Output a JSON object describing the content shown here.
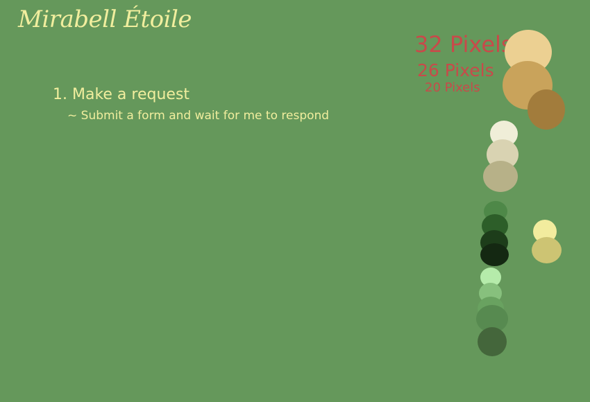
{
  "brand": {
    "name": "Mirabell Étoile"
  },
  "steps": [
    {
      "title": "1. Make a request",
      "description": "~ Submit a form and wait for me to respond"
    }
  ],
  "size_samples": {
    "large": "32 Pixels",
    "medium": "26 Pixels",
    "small": "20 Pixels"
  },
  "colors": {
    "background": "#65985b",
    "text": "#f1ee9e",
    "size_label": "#c84a4a",
    "swatches": {
      "tan": [
        "#ecd092",
        "#c9a35b",
        "#a27c3c"
      ],
      "cream": [
        "#f0eed8",
        "#d9d3b2",
        "#b7b188"
      ],
      "forest": [
        "#4e8848",
        "#2d5e29",
        "#1d3d1a",
        "#142812"
      ],
      "yellow": [
        "#f2ec9e",
        "#cdc473"
      ],
      "mint": [
        "#b5ebaa",
        "#87c07d",
        "#69a260",
        "#578a50",
        "#44663b"
      ]
    }
  }
}
